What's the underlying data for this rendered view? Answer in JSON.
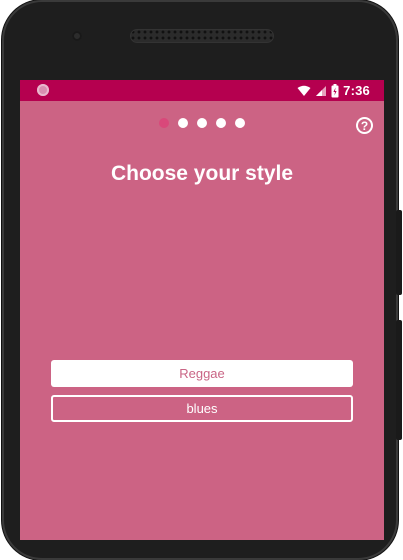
{
  "status_bar": {
    "time": "7:36",
    "icons": [
      "notification-icon",
      "wifi-icon",
      "signal-icon",
      "battery-icon"
    ],
    "color": "#b5004f"
  },
  "onboarding": {
    "page_indicator": {
      "total": 5,
      "current": 1
    },
    "help_label": "?",
    "title": "Choose your style",
    "options": [
      {
        "label": "Reggae",
        "style": "filled"
      },
      {
        "label": "blues",
        "style": "outline"
      }
    ],
    "background": "#cc6384"
  }
}
